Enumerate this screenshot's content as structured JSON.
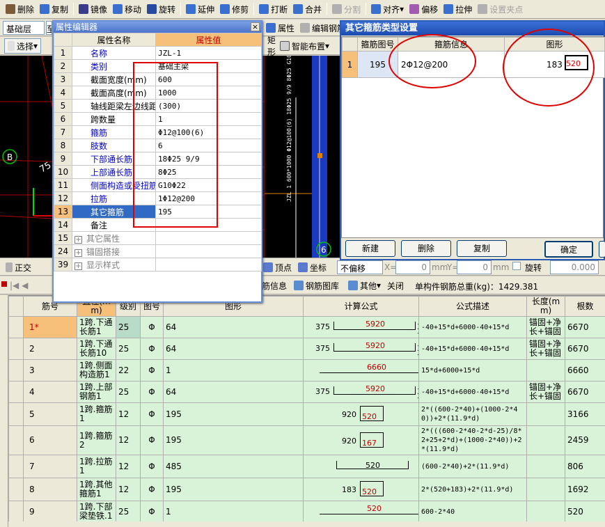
{
  "toolbar": {
    "items": [
      {
        "label": "删除",
        "icon": "eraser-icon",
        "enabled": true
      },
      {
        "label": "复制",
        "icon": "copy-icon",
        "enabled": true
      },
      {
        "label": "镜像",
        "icon": "mirror-icon",
        "enabled": true
      },
      {
        "label": "移动",
        "icon": "move-icon",
        "enabled": true
      },
      {
        "label": "旋转",
        "icon": "rotate-icon",
        "enabled": true
      },
      {
        "label": "延伸",
        "icon": "extend-icon",
        "enabled": true
      },
      {
        "label": "修剪",
        "icon": "trim-icon",
        "enabled": true
      },
      {
        "label": "打断",
        "icon": "break-icon",
        "enabled": true
      },
      {
        "label": "合并",
        "icon": "merge-icon",
        "enabled": true
      },
      {
        "label": "分割",
        "icon": "split-icon",
        "enabled": false
      },
      {
        "label": "对齐",
        "icon": "align-icon",
        "enabled": true
      },
      {
        "label": "偏移",
        "icon": "offset-icon",
        "enabled": true
      },
      {
        "label": "拉伸",
        "icon": "stretch-icon",
        "enabled": true
      },
      {
        "label": "设置夹点",
        "icon": "grip-icon",
        "enabled": false
      }
    ]
  },
  "row2": {
    "layer": "基础层",
    "tail": "至"
  },
  "row3": {
    "select": "选择",
    "shape": "矩形",
    "smart": "智能布置",
    "attr": "属性",
    "edit_rebar": "编辑钢筋"
  },
  "cad": {
    "axis_label": "B",
    "axis_label2": "6",
    "vertical_text": "JZL 1 600*1000 Φ12@100(6) 18Φ25 9/9 8Φ25 G10Φ22",
    "angle_text": "75"
  },
  "strip": {
    "ortho": "正交",
    "vertex": "顶点",
    "coord": "坐标",
    "offset": "不偏移",
    "x_label": "X=",
    "x_val": "0",
    "mm1": "mm",
    "y_label": "Y=",
    "y_val": "0",
    "mm2": "mm",
    "rotate": "旋转",
    "rot_val": "0.000"
  },
  "strip2": {
    "rebar_info": "筋信息",
    "rebar_lib": "钢筋图库",
    "other": "其他",
    "close": "关闭",
    "total_label": "单构件钢筋总重(kg)：1429.381"
  },
  "prop_editor": {
    "title": "属性编辑器",
    "col_name": "属性名称",
    "col_value": "属性值",
    "rows": [
      {
        "n": "1",
        "name": "名称",
        "value": "JZL-1",
        "blue": true
      },
      {
        "n": "2",
        "name": "类别",
        "value": "基础主梁",
        "blue": true
      },
      {
        "n": "3",
        "name": "截面宽度(mm)",
        "value": "600",
        "blue": false
      },
      {
        "n": "4",
        "name": "截面高度(mm)",
        "value": "1000",
        "blue": false
      },
      {
        "n": "5",
        "name": "轴线距梁左边线距",
        "value": "(300)",
        "blue": false
      },
      {
        "n": "6",
        "name": "跨数量",
        "value": "1",
        "blue": false
      },
      {
        "n": "7",
        "name": "箍筋",
        "value": "Φ12@100(6)",
        "blue": true
      },
      {
        "n": "8",
        "name": "肢数",
        "value": "6",
        "blue": true
      },
      {
        "n": "9",
        "name": "下部通长筋",
        "value": "18Φ25 9/9",
        "blue": true
      },
      {
        "n": "10",
        "name": "上部通长筋",
        "value": "8Φ25",
        "blue": true
      },
      {
        "n": "11",
        "name": "侧面构造或受扭筋",
        "value": "G10Φ22",
        "blue": true
      },
      {
        "n": "12",
        "name": "拉筋",
        "value": "1Φ12@200",
        "blue": true
      },
      {
        "n": "13",
        "name": "其它箍筋",
        "value": "195",
        "blue": false
      },
      {
        "n": "14",
        "name": "备注",
        "value": "",
        "blue": false
      },
      {
        "n": "15",
        "name": "其它属性",
        "value": "",
        "blue": false
      },
      {
        "n": "24",
        "name": "锚固搭接",
        "value": "",
        "blue": false
      },
      {
        "n": "39",
        "name": "显示样式",
        "value": "",
        "blue": false
      }
    ]
  },
  "other_dialog": {
    "title": "其它箍筋类型设置",
    "col_code": "箍筋图号",
    "col_info": "箍筋信息",
    "col_shape": "图形",
    "rows": [
      {
        "n": "1",
        "code": "195",
        "info": "2Φ12@200",
        "shape_left": "183",
        "shape_val": "520"
      }
    ],
    "btn_new": "新建",
    "btn_delete": "删除",
    "btn_copy": "复制",
    "btn_ok": "确定"
  },
  "grid": {
    "headers": [
      "筋号",
      "直径(mm)",
      "级别",
      "图号",
      "图形",
      "计算公式",
      "公式描述",
      "长度(mm)",
      "根数"
    ],
    "rows": [
      {
        "n": "1*",
        "name": "1跨.下通长筋1",
        "dia": "25",
        "grade": "Φ",
        "code": "64",
        "s_left": "375",
        "s_mid": "5920",
        "s_right": "375",
        "formula": "-40+15*d+6000-40+15*d",
        "desc": "锚固+净长+锚固",
        "len": "6670",
        "count": "9",
        "type": "bar"
      },
      {
        "n": "2",
        "name": "1跨.下通长筋10",
        "dia": "25",
        "grade": "Φ",
        "code": "64",
        "s_left": "375",
        "s_mid": "5920",
        "s_right": "375",
        "formula": "-40+15*d+6000-40+15*d",
        "desc": "锚固+净长+锚固",
        "len": "6670",
        "count": "9",
        "type": "bar"
      },
      {
        "n": "3",
        "name": "1跨.侧面构造筋1",
        "dia": "22",
        "grade": "Φ",
        "code": "1",
        "s_left": "",
        "s_mid": "6660",
        "s_right": "",
        "formula": "15*d+6000+15*d",
        "desc": "",
        "len": "6660",
        "count": "10",
        "type": "line"
      },
      {
        "n": "4",
        "name": "1跨.上部钢筋1",
        "dia": "25",
        "grade": "Φ",
        "code": "64",
        "s_left": "375",
        "s_mid": "5920",
        "s_right": "375",
        "formula": "-40+15*d+6000-40+15*d",
        "desc": "锚固+净长+锚固",
        "len": "6670",
        "count": "8",
        "type": "bar"
      },
      {
        "n": "5",
        "name": "1跨.箍筋1",
        "dia": "12",
        "grade": "Φ",
        "code": "195",
        "s_left": "920",
        "s_mid": "520",
        "s_right": "",
        "formula": "2*((600-2*40)+(1000-2*40))+2*(11.9*d)",
        "desc": "",
        "len": "3166",
        "count": "61",
        "type": "hoop"
      },
      {
        "n": "6",
        "name": "1跨.箍筋2",
        "dia": "12",
        "grade": "Φ",
        "code": "195",
        "s_left": "920",
        "s_mid": "167",
        "s_right": "",
        "formula": "2*(((600-2*40-2*d-25)/8*2+25+2*d)+(1000-2*40))+2*(11.9*d)",
        "desc": "",
        "len": "2459",
        "count": "122",
        "type": "hoop"
      },
      {
        "n": "7",
        "name": "1跨.拉筋1",
        "dia": "12",
        "grade": "Φ",
        "code": "485",
        "s_left": "",
        "s_mid": "520",
        "s_right": "",
        "formula": "(600-2*40)+2*(11.9*d)",
        "desc": "",
        "len": "806",
        "count": "31",
        "type": "tie"
      },
      {
        "n": "8",
        "name": "1跨.其他箍筋1",
        "dia": "12",
        "grade": "Φ",
        "code": "195",
        "s_left": "183",
        "s_mid": "520",
        "s_right": "",
        "formula": "2*(520+183)+2*(11.9*d)",
        "desc": "",
        "len": "1692",
        "count": "62",
        "type": "hoop"
      },
      {
        "n": "9",
        "name": "1跨.下部梁垫铁.1",
        "dia": "25",
        "grade": "Φ",
        "code": "1",
        "s_left": "",
        "s_mid": "520",
        "s_right": "",
        "formula": "600-2*40",
        "desc": "",
        "len": "520",
        "count": "5",
        "type": "line"
      }
    ]
  }
}
